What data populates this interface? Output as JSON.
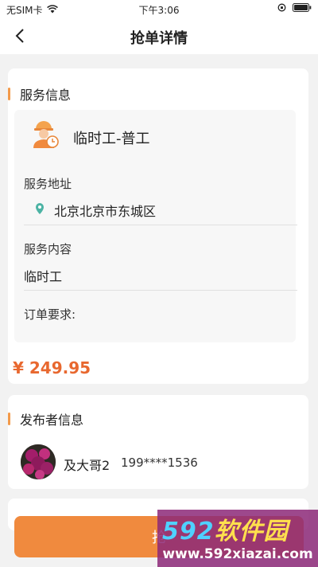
{
  "status_bar": {
    "carrier": "无SIM卡",
    "time": "下午3:06"
  },
  "nav": {
    "title": "抢单详情"
  },
  "service_info": {
    "section_title": "服务信息",
    "job_title": "临时工-普工",
    "address_label": "服务地址",
    "address": "北京北京市东城区",
    "content_label": "服务内容",
    "content": "临时工",
    "requirement_label": "订单要求:",
    "price": "¥ 249.95"
  },
  "publisher": {
    "section_title": "发布者信息",
    "name": "及大哥2",
    "phone": "199****1536"
  },
  "action": {
    "grab_button": "抢"
  },
  "watermark": {
    "brand_digits": "592",
    "brand_text": "软件园",
    "url": "www.592xiazai.com"
  },
  "colors": {
    "accent": "#f39a4a",
    "price": "#e8682f",
    "button": "#f08a3e"
  }
}
